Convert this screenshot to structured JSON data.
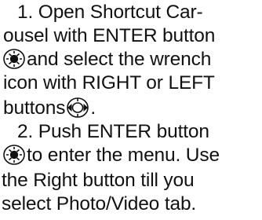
{
  "instructions": {
    "step1_line1": "1. Open Shortcut Car-",
    "step1_line2": "ousel with ENTER button",
    "step1_line3": " and select the wrench",
    "step1_line4": "icon with RIGHT or LEFT",
    "step1_line5_text": "buttons ",
    "step1_line5_end": ".",
    "step2_line1": "2. Push ENTER button",
    "step2_line2": " to enter the menu. Use",
    "step2_line3": "the Right button till you",
    "step2_line4": "select Photo/Video tab."
  },
  "icons": {
    "enter": "enter-button-icon",
    "left_right": "left-right-button-icon"
  },
  "colors": {
    "text": "#111111",
    "icon_stroke": "#111111"
  }
}
